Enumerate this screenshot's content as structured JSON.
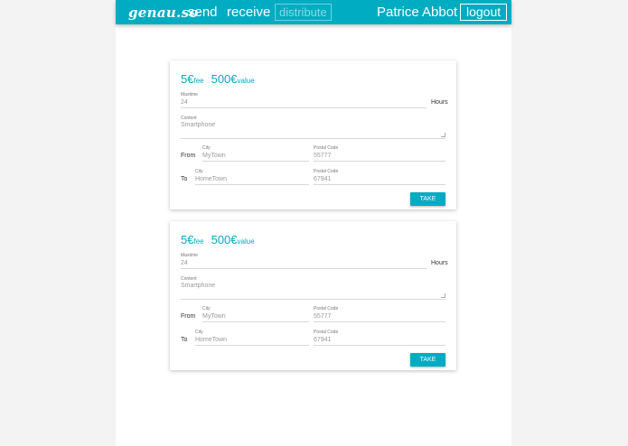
{
  "navbar": {
    "brand": "genau.so",
    "links": [
      "send",
      "receive"
    ],
    "distribute": "distribute",
    "user_name": "Patrice Abbot",
    "logout": "logout"
  },
  "cards": [
    {
      "fee_amount": "5€",
      "fee_label": "fee",
      "value_amount": "500€",
      "value_label": "value",
      "maxtime_label": "Maxtime",
      "maxtime_value": "24",
      "hours_label": "Hours",
      "content_label": "Content",
      "content_value": "Smartphone",
      "from_label": "From",
      "from_city_label": "City",
      "from_city": "MyTown",
      "from_postal_label": "Postal Code",
      "from_postal": "55777",
      "to_label": "To",
      "to_city_label": "City",
      "to_city": "HomeTown",
      "to_postal_label": "Postal Code",
      "to_postal": "67941",
      "take": "TAKE"
    },
    {
      "fee_amount": "5€",
      "fee_label": "fee",
      "value_amount": "500€",
      "value_label": "value",
      "maxtime_label": "Maxtime",
      "maxtime_value": "24",
      "hours_label": "Hours",
      "content_label": "Content",
      "content_value": "Smartphone",
      "from_label": "From",
      "from_city_label": "City",
      "from_city": "MyTown",
      "from_postal_label": "Postal Code",
      "from_postal": "55777",
      "to_label": "To",
      "to_city_label": "City",
      "to_city": "HomeTown",
      "to_postal_label": "Postal Code",
      "to_postal": "67941",
      "take": "TAKE"
    }
  ],
  "colors": {
    "accent": "#00acc1",
    "page_background": "#f3f3f3"
  }
}
